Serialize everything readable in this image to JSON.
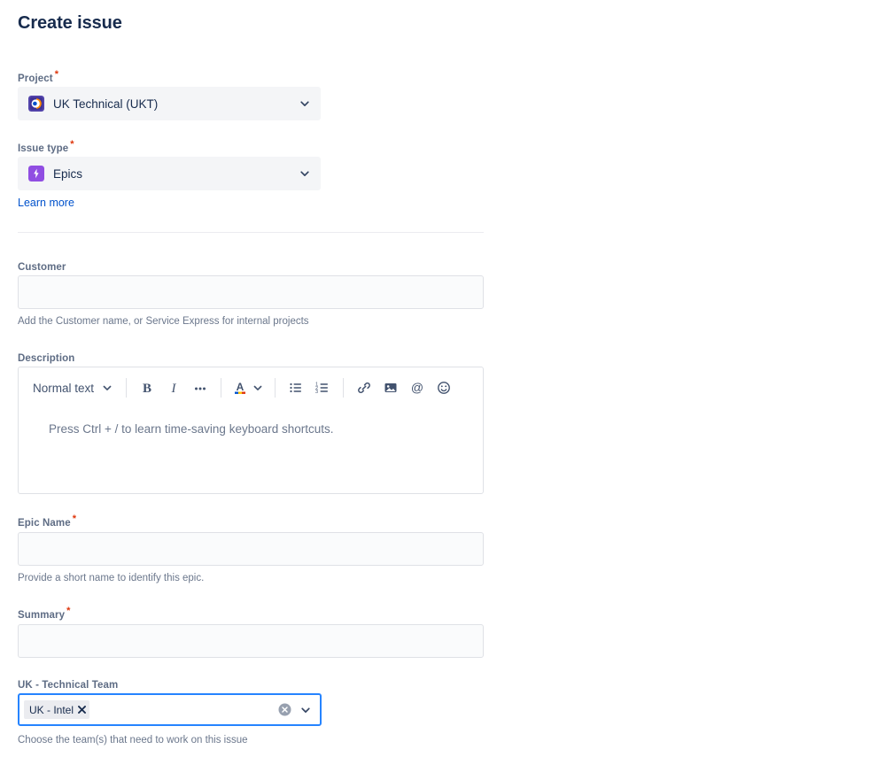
{
  "header": {
    "title": "Create issue"
  },
  "form": {
    "project": {
      "label": "Project",
      "required_marker": "*",
      "value": "UK Technical (UKT)",
      "icon": "project-avatar-icon",
      "chevron": "chevron-down-icon"
    },
    "issue_type": {
      "label": "Issue type",
      "required_marker": "*",
      "value": "Epics",
      "icon": "epic-bolt-icon",
      "chevron": "chevron-down-icon",
      "learn_more": "Learn more"
    },
    "customer": {
      "label": "Customer",
      "value": "",
      "placeholder": "",
      "help": "Add the Customer name, or Service Express for internal projects"
    },
    "description": {
      "label": "Description",
      "placeholder": "Press Ctrl + / to learn time-saving keyboard shortcuts.",
      "toolbar": {
        "text_style": "Normal text",
        "buttons": [
          {
            "name": "bold-icon",
            "glyph": "B"
          },
          {
            "name": "italic-icon",
            "glyph": "I"
          },
          {
            "name": "more-formatting-icon",
            "glyph": "…"
          },
          {
            "name": "text-color-icon",
            "glyph": "A"
          },
          {
            "name": "bullet-list-icon",
            "glyph": ""
          },
          {
            "name": "numbered-list-icon",
            "glyph": ""
          },
          {
            "name": "link-icon",
            "glyph": ""
          },
          {
            "name": "image-icon",
            "glyph": ""
          },
          {
            "name": "mention-icon",
            "glyph": "@"
          },
          {
            "name": "emoji-icon",
            "glyph": ""
          }
        ]
      }
    },
    "epic_name": {
      "label": "Epic Name",
      "required_marker": "*",
      "value": "",
      "placeholder": "",
      "help": "Provide a short name to identify this epic."
    },
    "summary": {
      "label": "Summary",
      "required_marker": "*",
      "value": "",
      "placeholder": ""
    },
    "technical_team": {
      "label": "UK - Technical Team",
      "selected_tags": [
        {
          "label": "UK - Intel",
          "remove": "✕"
        }
      ],
      "clear_icon": "clear-all-icon",
      "chevron": "chevron-down-icon",
      "help": "Choose the team(s) that need to work on this issue"
    }
  },
  "colors": {
    "link": "#0052CC",
    "required": "#DE350B",
    "focus_border": "#2684FF",
    "text": "#172B4D",
    "label": "#5E6C84",
    "field_bg": "#FAFBFC",
    "select_bg": "#F4F5F7"
  }
}
